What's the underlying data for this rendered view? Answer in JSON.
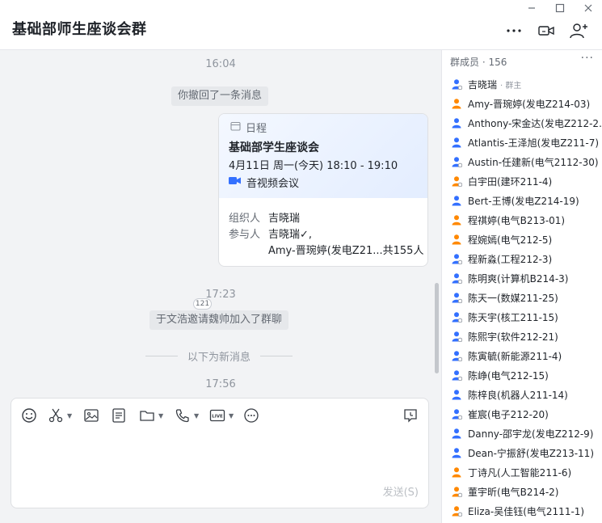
{
  "header": {
    "title": "基础部师生座谈会群"
  },
  "chat": {
    "time1": "16:04",
    "recall_msg": "你撤回了一条消息",
    "card": {
      "tag": "日程",
      "title": "基础部学生座谈会",
      "datetime": "4月11日 周一(今天) 18:10 - 19:10",
      "meeting": "音视频会议",
      "organizer_label": "组织人",
      "organizer": "吉晓瑞",
      "attendee_label": "参与人",
      "attendee_line1": "吉晓瑞✓,",
      "attendee_line2": "Amy-晋琬婷(发电Z21...共155人"
    },
    "read_badge": "121",
    "time2": "17:23",
    "invite_msg": "于文浩邀请魏帅加入了群聊",
    "new_divider": "以下为新消息",
    "time3": "17:56"
  },
  "composer": {
    "send_label": "发送(S)"
  },
  "sidebar": {
    "header": "群成员 · 156",
    "more": "···",
    "members": [
      {
        "name": "吉晓瑞",
        "role": "· 群主",
        "color": "#3370ff",
        "badge": true
      },
      {
        "name": "Amy-晋琬婷(发电Z214-03)",
        "color": "#ff8800",
        "badge": false
      },
      {
        "name": "Anthony-宋金达(发电Z212-2...",
        "color": "#3370ff",
        "badge": false
      },
      {
        "name": "Atlantis-王泽旭(发电Z211-7)",
        "color": "#3370ff",
        "badge": false
      },
      {
        "name": "Austin-任建新(电气2112-30)",
        "color": "#3370ff",
        "badge": true
      },
      {
        "name": "白宇田(建环211-4)",
        "color": "#ff8800",
        "badge": true
      },
      {
        "name": "Bert-王博(发电Z214-19)",
        "color": "#3370ff",
        "badge": false
      },
      {
        "name": "程祺婷(电气B213-01)",
        "color": "#ff8800",
        "badge": false
      },
      {
        "name": "程婉嫣(电气212-5)",
        "color": "#ff8800",
        "badge": false
      },
      {
        "name": "程新淼(工程212-3)",
        "color": "#3370ff",
        "badge": true
      },
      {
        "name": "陈明爽(计算机B214-3)",
        "color": "#3370ff",
        "badge": true
      },
      {
        "name": "陈天一(数媒211-25)",
        "color": "#3370ff",
        "badge": true
      },
      {
        "name": "陈天宇(核工211-15)",
        "color": "#3370ff",
        "badge": true
      },
      {
        "name": "陈熙宇(软件212-21)",
        "color": "#3370ff",
        "badge": true
      },
      {
        "name": "陈寅毓(新能源211-4)",
        "color": "#3370ff",
        "badge": true
      },
      {
        "name": "陈峥(电气212-15)",
        "color": "#3370ff",
        "badge": true
      },
      {
        "name": "陈梓良(机器人211-14)",
        "color": "#3370ff",
        "badge": false
      },
      {
        "name": "崔宸(电子212-20)",
        "color": "#3370ff",
        "badge": true
      },
      {
        "name": "Danny-邵宇龙(发电Z212-9)",
        "color": "#3370ff",
        "badge": false
      },
      {
        "name": "Dean-宁振舒(发电Z213-11)",
        "color": "#3370ff",
        "badge": false
      },
      {
        "name": "丁诗凡(人工智能211-6)",
        "color": "#ff8800",
        "badge": false
      },
      {
        "name": "董宇昕(电气B214-2)",
        "color": "#ff8800",
        "badge": true
      },
      {
        "name": "Eliza-吴佳钰(电气2111-1)",
        "color": "#ff8800",
        "badge": true
      }
    ]
  },
  "colors": {
    "accent": "#3370ff",
    "orange": "#ff8800"
  }
}
